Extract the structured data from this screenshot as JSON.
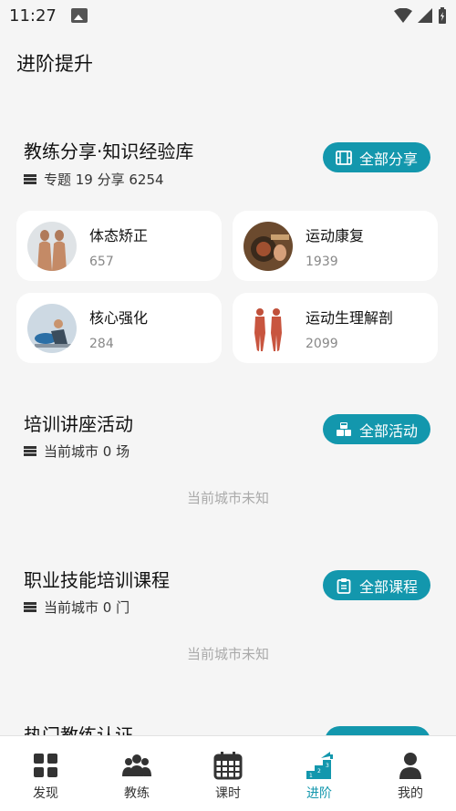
{
  "status": {
    "time": "11:27"
  },
  "page_title": "进阶提升",
  "share": {
    "title": "教练分享·知识经验库",
    "sub": "专题 19 分享 6254",
    "button": "全部分享",
    "items": [
      {
        "name": "体态矫正",
        "count": "657"
      },
      {
        "name": "运动康复",
        "count": "1939"
      },
      {
        "name": "核心强化",
        "count": "284"
      },
      {
        "name": "运动生理解剖",
        "count": "2099"
      }
    ]
  },
  "lecture": {
    "title": "培训讲座活动",
    "sub": "当前城市 0 场",
    "button": "全部活动",
    "empty": "当前城市未知"
  },
  "course": {
    "title": "职业技能培训课程",
    "sub": "当前城市 0 门",
    "button": "全部课程",
    "empty": "当前城市未知"
  },
  "cert": {
    "title": "热门教练认证"
  },
  "tabs": [
    {
      "label": "发现",
      "icon": "grid-icon"
    },
    {
      "label": "教练",
      "icon": "group-icon"
    },
    {
      "label": "课时",
      "icon": "calendar-icon"
    },
    {
      "label": "进阶",
      "icon": "podium-icon",
      "active": true
    },
    {
      "label": "我的",
      "icon": "user-icon"
    }
  ],
  "colors": {
    "accent": "#1397ad",
    "background": "#f5f5f5"
  }
}
